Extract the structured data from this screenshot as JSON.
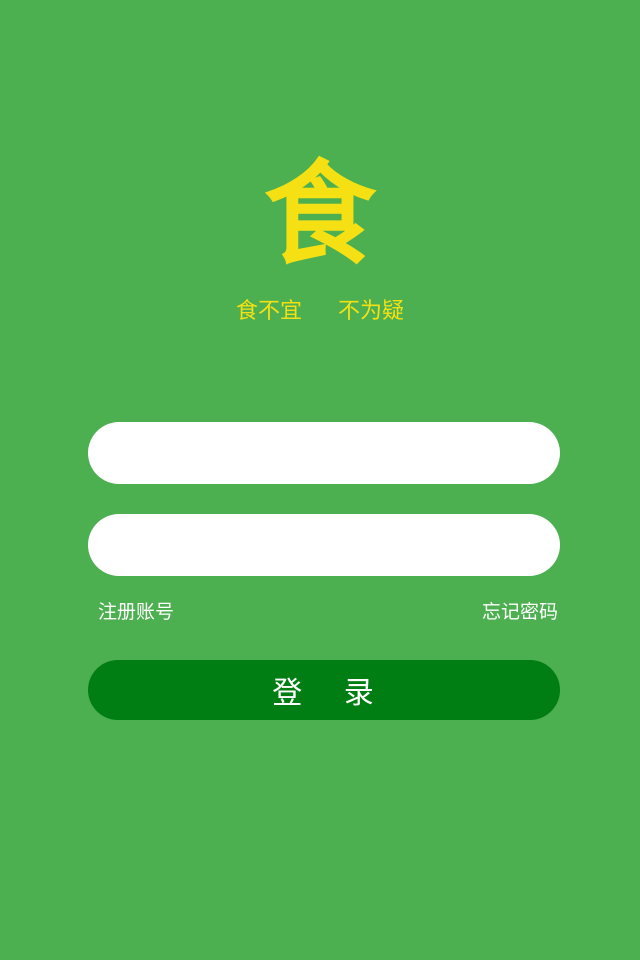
{
  "logo": {
    "glyph": "食"
  },
  "slogan": {
    "part1": "食不宜",
    "part2": "不为疑"
  },
  "form": {
    "username": {
      "value": "",
      "placeholder": ""
    },
    "password": {
      "value": "",
      "placeholder": ""
    },
    "register_label": "注册账号",
    "forgot_label": "忘记密码",
    "login_label": "登 录"
  },
  "colors": {
    "background": "#4caf50",
    "accent_yellow": "#f5e014",
    "button": "#007e13",
    "input": "#ffffff",
    "link_text": "#ffffff"
  }
}
